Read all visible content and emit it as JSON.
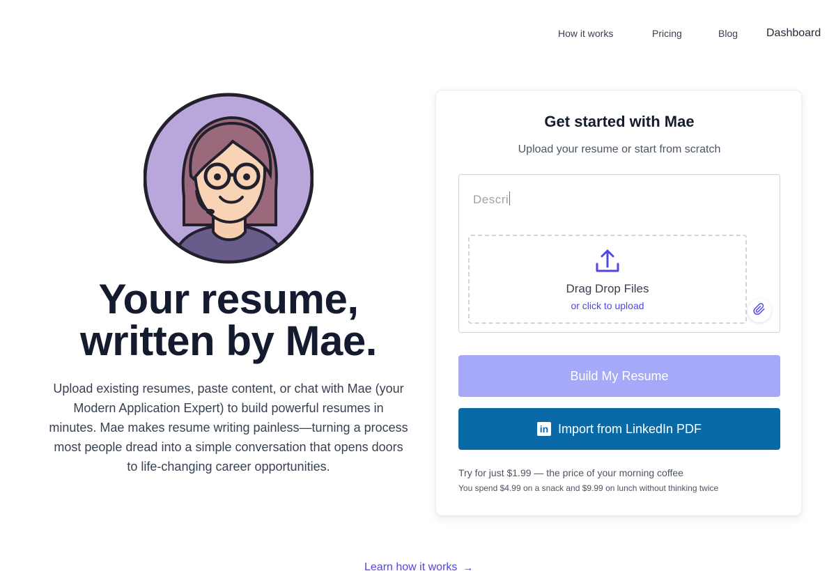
{
  "nav": {
    "how_it_works": "How it works",
    "pricing": "Pricing",
    "blog": "Blog",
    "dashboard": "Dashboard"
  },
  "hero": {
    "title_line1": "Your resume,",
    "title_line2": "written by Mae.",
    "description": "Upload existing resumes, paste content, or chat with Mae (your Modern Application Expert) to build powerful resumes in minutes. Mae makes resume writing painless—turning a process most people dread into a simple conversation that opens doors to life-changing career opportunities.",
    "avatar_icon": "mae-avatar-icon"
  },
  "card": {
    "title": "Get started with Mae",
    "subtitle": "Upload your resume or start from scratch",
    "input": {
      "value": "Descri"
    },
    "dropzone": {
      "icon": "upload-icon",
      "title": "Drag Drop Files",
      "link": "or click to upload"
    },
    "attach_icon": "paperclip-icon",
    "build_button": "Build My Resume",
    "linkedin_button": "Import from LinkedIn PDF",
    "linkedin_icon": "linkedin-icon",
    "price_line": "Try for just $1.99 — the price of your morning coffee",
    "price_sub": "You spend $4.99 on a snack and $9.99 on lunch without thinking twice"
  },
  "footer": {
    "learn_link": "Learn how it works",
    "arrow": "→"
  },
  "colors": {
    "accent": "#4f46e5",
    "build_button_bg": "#a5a9f7",
    "linkedin_bg": "#0a6aa8",
    "avatar_bg": "#b9a6db"
  }
}
